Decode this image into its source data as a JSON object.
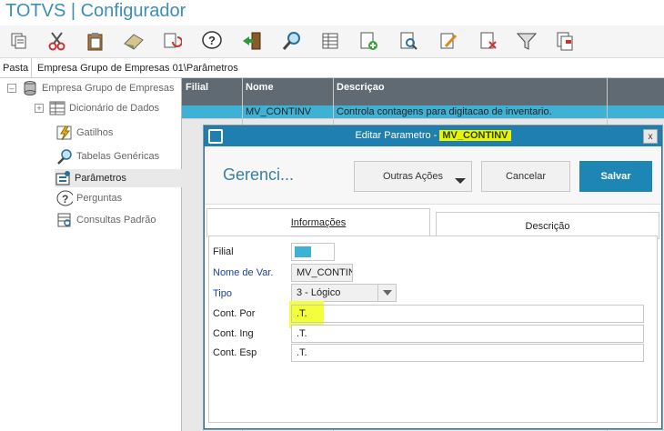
{
  "app": {
    "title": "TOTVS | Configurador"
  },
  "toolbar": {
    "icons": [
      "copy-icon",
      "scissors-icon",
      "paste-icon",
      "eraser-icon",
      "refresh-icon",
      "help-icon",
      "exit-icon",
      "search-icon",
      "grid-icon",
      "add-doc-icon",
      "preview-icon",
      "edit-icon",
      "delete-doc-icon",
      "filter-icon",
      "print-icon"
    ]
  },
  "path": {
    "label": "Pasta",
    "value": "Empresa Grupo de Empresas 01\\Parâmetros"
  },
  "tree": {
    "items": [
      {
        "label": "Empresa Grupo de Empresas"
      },
      {
        "label": "Dicionário de Dados"
      },
      {
        "label": "Gatilhos"
      },
      {
        "label": "Tabelas Genéricas"
      },
      {
        "label": "Parâmetros"
      },
      {
        "label": "Perguntas"
      },
      {
        "label": "Consultas Padrão"
      }
    ]
  },
  "grid": {
    "headers": [
      "Filial",
      "Nome",
      "Descriçao"
    ],
    "selected_row": {
      "filial": "",
      "nome": "MV_CONTINV",
      "descricao": "Controla contagens para digitacao de inventario."
    }
  },
  "dialog": {
    "title_prefix": "Editar Parametro - ",
    "title_param": "MV_CONTINV",
    "close": "x",
    "header": "Gerenci...",
    "buttons": {
      "more": "Outras Ações",
      "cancel": "Cancelar",
      "save": "Salvar"
    },
    "tabs": {
      "info": "Informações",
      "desc": "Descrição"
    },
    "fields": {
      "filial": {
        "label": "Filial",
        "value": ""
      },
      "nome": {
        "label": "Nome de Var.",
        "value": "MV_CONTINV"
      },
      "tipo": {
        "label": "Tipo",
        "value": "3 - Lógico"
      },
      "cont_por": {
        "label": "Cont. Por",
        "value": ".T."
      },
      "cont_ing": {
        "label": "Cont. Ing",
        "value": ".T."
      },
      "cont_esp": {
        "label": "Cont. Esp",
        "value": ".T."
      }
    }
  },
  "colors": {
    "accent": "#1e86b5",
    "highlight": "#e9f400",
    "selection": "#3fb1d4"
  }
}
